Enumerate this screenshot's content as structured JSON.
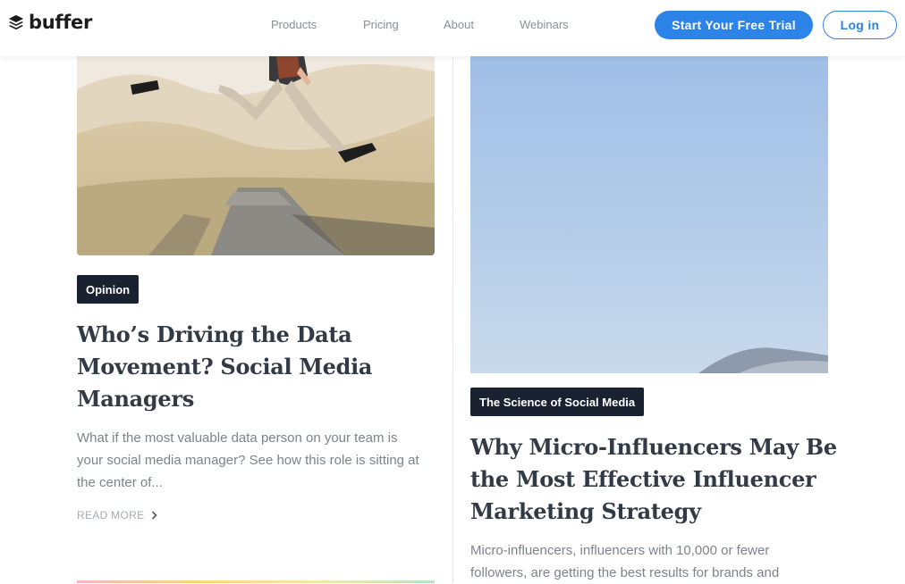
{
  "nav": {
    "logo_text": "buffer",
    "links": [
      "Products",
      "Pricing",
      "About",
      "Webinars"
    ],
    "cta_label": "Start Your Free Trial",
    "login_label": "Log in"
  },
  "articles": [
    {
      "tag": "Opinion",
      "title_lines": [
        "Who’s Driving the Data",
        "Movement? Social Media",
        "Managers"
      ],
      "excerpt_lines": [
        "What if the most valuable data person on your team is",
        "your social media manager? See how this role is sitting at",
        "the center of..."
      ],
      "read_more": "READ MORE"
    },
    {
      "tag": "The Science of Social Media",
      "title_lines": [
        "Why Micro-Influencers May Be",
        "the Most Effective Influencer",
        "Marketing Strategy"
      ],
      "excerpt_lines": [
        "Micro-influencers, influencers with 10,000 or fewer",
        "followers, are getting the best results for brands and"
      ]
    }
  ],
  "colors": {
    "brand_blue": "#2c83e8",
    "tag_bg": "#1a2131",
    "title": "#313a45",
    "excerpt": "#7d838b"
  },
  "icons": [
    "buffer-logo-icon",
    "chevron-right-icon"
  ]
}
